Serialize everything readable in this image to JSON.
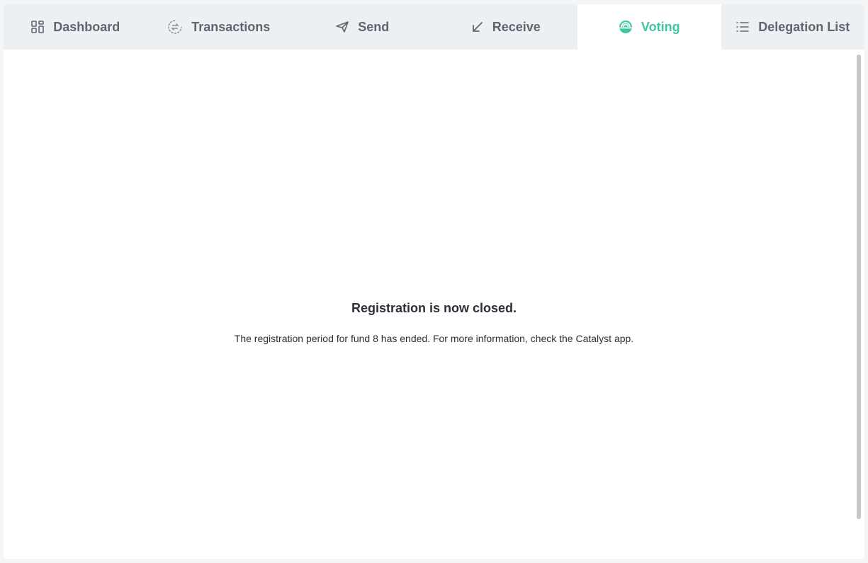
{
  "tabs": [
    {
      "label": "Dashboard",
      "icon": "dashboard-icon",
      "active": false
    },
    {
      "label": "Transactions",
      "icon": "transactions-icon",
      "active": false
    },
    {
      "label": "Send",
      "icon": "send-icon",
      "active": false
    },
    {
      "label": "Receive",
      "icon": "receive-icon",
      "active": false
    },
    {
      "label": "Voting",
      "icon": "voting-icon",
      "active": true
    },
    {
      "label": "Delegation List",
      "icon": "list-icon",
      "active": false
    }
  ],
  "voting": {
    "title": "Registration is now closed.",
    "description": "The registration period for fund 8 has ended. For more information, check the Catalyst app."
  },
  "colors": {
    "accent": "#3ec5a1",
    "tab_text": "#5f6470",
    "tabbar_bg": "#edf0f3",
    "text": "#2b2f38"
  }
}
